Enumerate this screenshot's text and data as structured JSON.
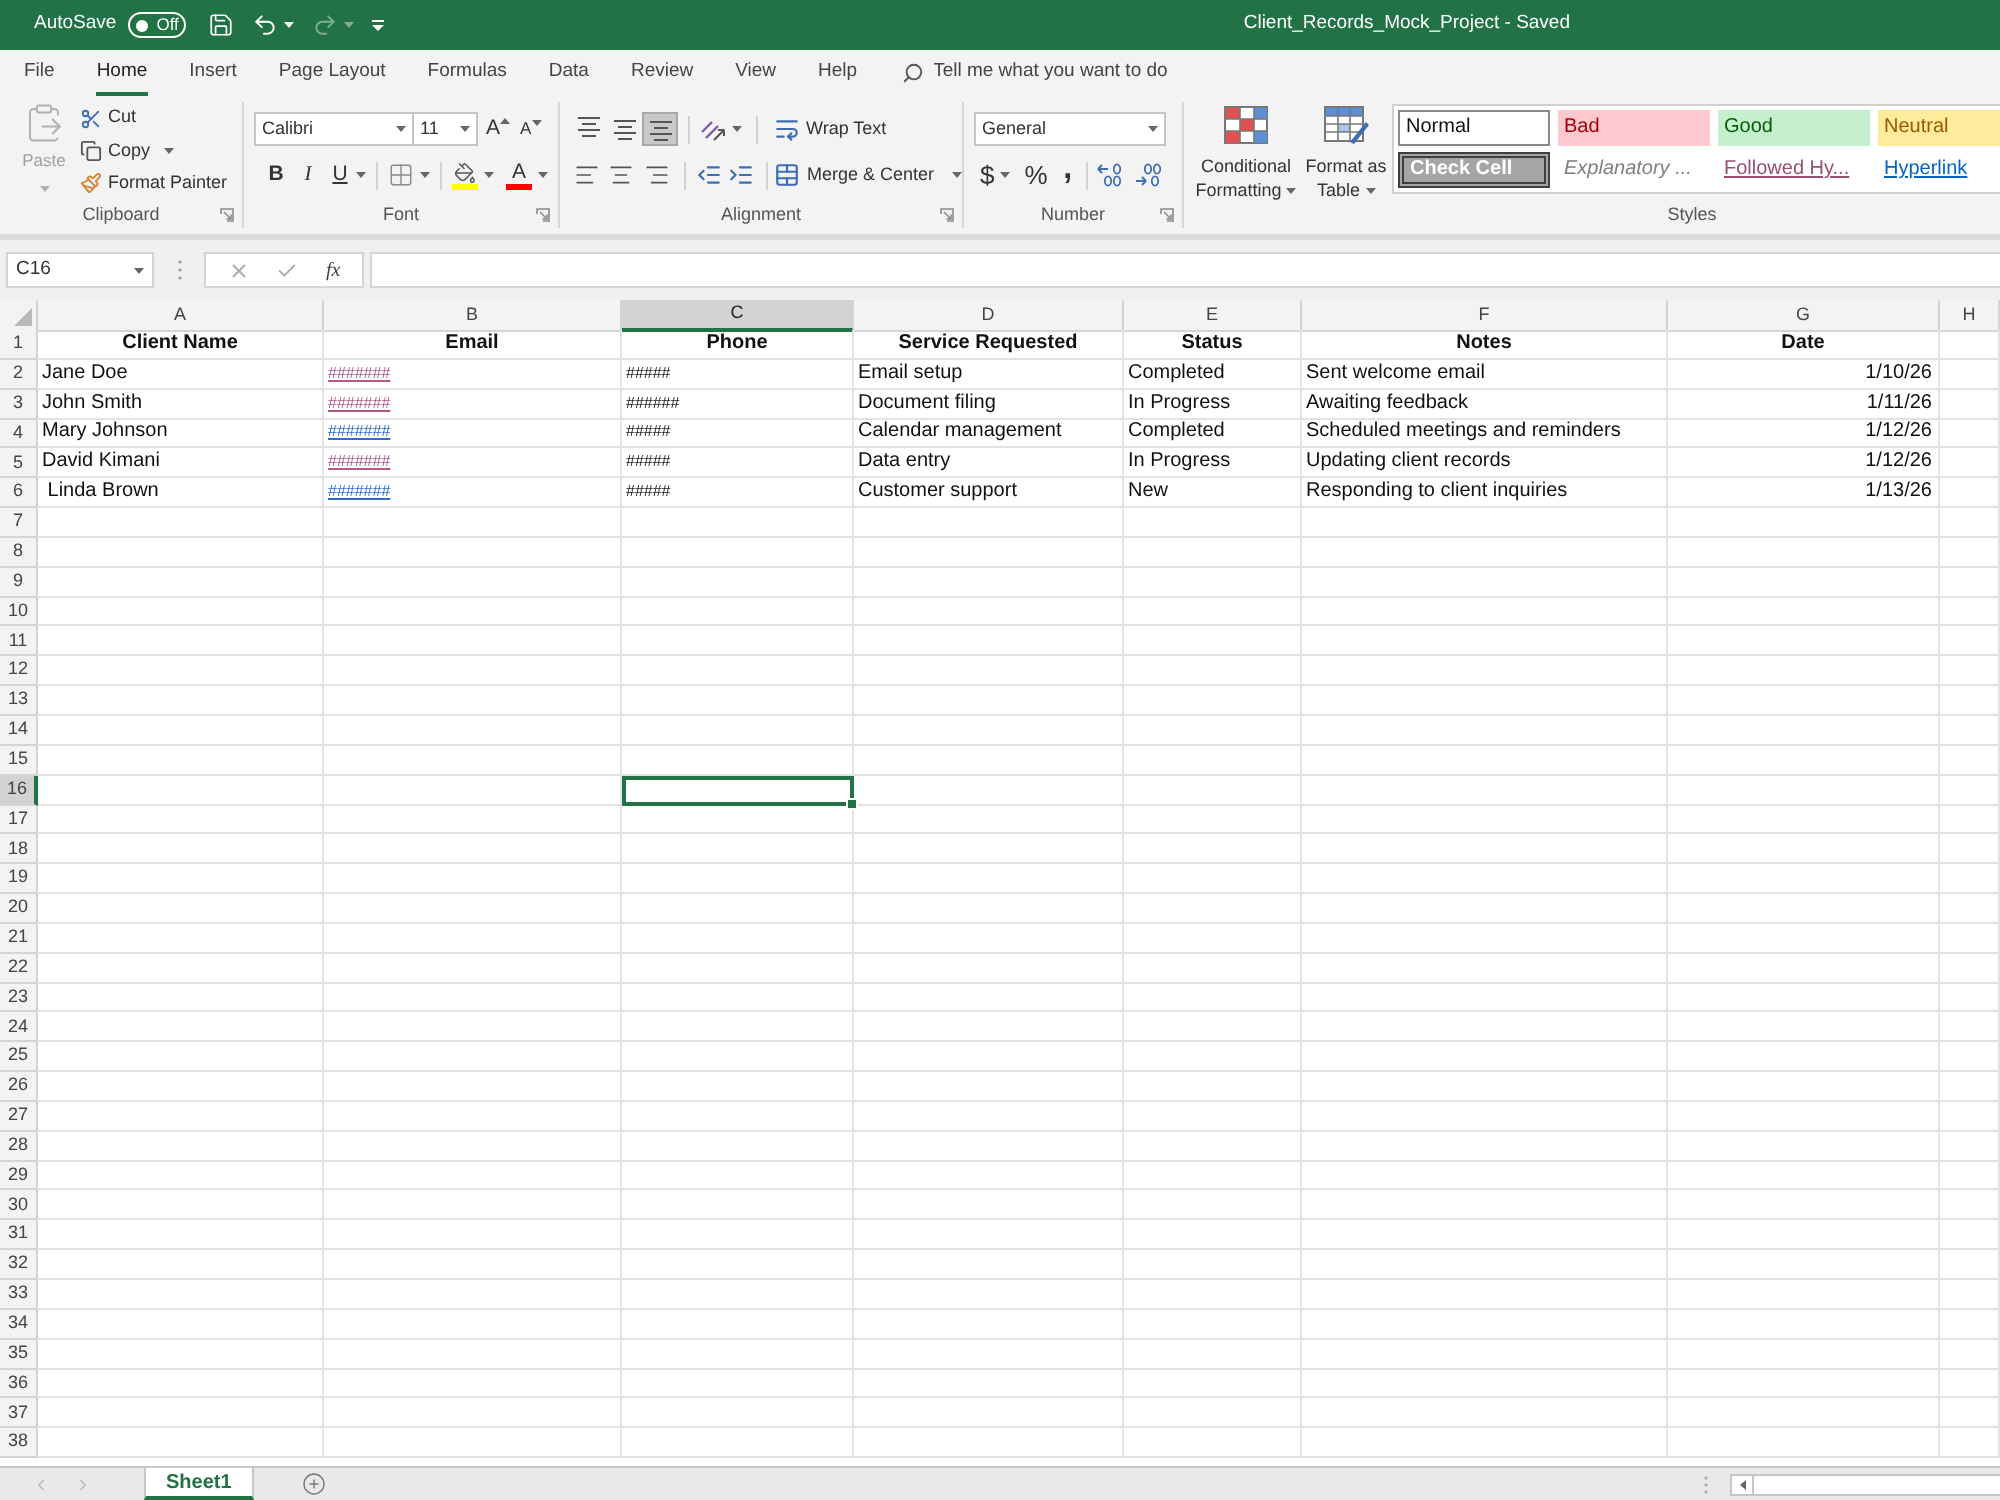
{
  "title_bar": {
    "autosave_label": "AutoSave",
    "autosave_toggle": {
      "label": "Off",
      "on": false
    },
    "quick_access": [
      {
        "kind": "save",
        "disabled": false
      },
      {
        "kind": "undo",
        "disabled": false
      },
      {
        "kind": "redo",
        "disabled": true
      },
      {
        "kind": "customize",
        "disabled": false
      }
    ],
    "title": "Client_Records_Mock_Project - Saved"
  },
  "menu_tabs": [
    {
      "label": "File",
      "selected": false
    },
    {
      "label": "Home",
      "selected": true
    },
    {
      "label": "Insert",
      "selected": false
    },
    {
      "label": "Page Layout",
      "selected": false
    },
    {
      "label": "Formulas",
      "selected": false
    },
    {
      "label": "Data",
      "selected": false
    },
    {
      "label": "Review",
      "selected": false
    },
    {
      "label": "View",
      "selected": false
    },
    {
      "label": "Help",
      "selected": false
    }
  ],
  "tell_me": {
    "placeholder": "Tell me what you want to do"
  },
  "ribbon": {
    "clipboard": {
      "label": "Clipboard",
      "paste": {
        "label": "Paste",
        "disabled": true
      },
      "cut": "Cut",
      "copy": "Copy",
      "format_painter": "Format Painter"
    },
    "font": {
      "label": "Font",
      "font_name": "Calibri",
      "font_size": "11",
      "grow_font": "A",
      "shrink_font": "A",
      "bold": "B",
      "italic": "I",
      "underline": "U",
      "font_color": "A"
    },
    "alignment": {
      "label": "Alignment",
      "vertical": [
        {
          "kind": "top",
          "selected": false
        },
        {
          "kind": "middle",
          "selected": false
        },
        {
          "kind": "bottom",
          "selected": true
        }
      ],
      "horizontal": [
        {
          "kind": "left",
          "selected": false
        },
        {
          "kind": "center",
          "selected": false
        },
        {
          "kind": "right",
          "selected": false
        }
      ],
      "wrap_text": "Wrap Text",
      "merge_center": "Merge & Center"
    },
    "number": {
      "label": "Number",
      "format": "General",
      "currency": "$",
      "percent": "%",
      "comma": ","
    },
    "styles": {
      "label": "Styles",
      "conditional_formatting": "Conditional Formatting",
      "format_as_table": "Format as Table",
      "gallery": [
        {
          "label": "Normal",
          "kind": "normal"
        },
        {
          "label": "Bad",
          "kind": "bad"
        },
        {
          "label": "Good",
          "kind": "good"
        },
        {
          "label": "Neutral",
          "kind": "neutral"
        },
        {
          "label": "Check Cell",
          "kind": "check"
        },
        {
          "label": "Explanatory ...",
          "kind": "explanatory"
        },
        {
          "label": "Followed Hy...",
          "kind": "followed"
        },
        {
          "label": "Hyperlink",
          "kind": "hyperlink"
        }
      ]
    }
  },
  "formula_bar": {
    "name_box": "C16",
    "function_label": "fx"
  },
  "sheet": {
    "columns": [
      {
        "label": "A",
        "selected": false
      },
      {
        "label": "B",
        "selected": false
      },
      {
        "label": "C",
        "selected": true
      },
      {
        "label": "D",
        "selected": false
      },
      {
        "label": "E",
        "selected": false
      },
      {
        "label": "F",
        "selected": false
      },
      {
        "label": "G",
        "selected": false
      },
      {
        "label": "H",
        "selected": false
      }
    ],
    "rows": [
      {
        "number": "1",
        "selected": false,
        "cells": [
          {
            "kind": "header",
            "text": "Client Name"
          },
          {
            "kind": "header",
            "text": "Email"
          },
          {
            "kind": "header",
            "text": "Phone"
          },
          {
            "kind": "header",
            "text": "Service Requested"
          },
          {
            "kind": "header",
            "text": "Status"
          },
          {
            "kind": "header",
            "text": "Notes"
          },
          {
            "kind": "header",
            "text": "Date"
          }
        ]
      },
      {
        "number": "2",
        "selected": false,
        "cells": [
          {
            "kind": "text",
            "text": "Jane Doe"
          },
          {
            "kind": "link",
            "text": "#######",
            "visited": true
          },
          {
            "kind": "number",
            "text": "#####"
          },
          {
            "kind": "text",
            "text": "Email setup"
          },
          {
            "kind": "text",
            "text": "Completed"
          },
          {
            "kind": "text",
            "text": "Sent welcome email"
          },
          {
            "kind": "date",
            "text": "1/10/26"
          }
        ]
      },
      {
        "number": "3",
        "selected": false,
        "cells": [
          {
            "kind": "text",
            "text": "John Smith"
          },
          {
            "kind": "link",
            "text": "#######",
            "visited": true
          },
          {
            "kind": "number",
            "text": "######"
          },
          {
            "kind": "text",
            "text": "Document filing"
          },
          {
            "kind": "text",
            "text": "In Progress"
          },
          {
            "kind": "text",
            "text": "Awaiting feedback"
          },
          {
            "kind": "date",
            "text": "1/11/26"
          }
        ]
      },
      {
        "number": "4",
        "selected": false,
        "cells": [
          {
            "kind": "text",
            "text": "Mary Johnson"
          },
          {
            "kind": "link",
            "text": "#######",
            "visited": false
          },
          {
            "kind": "number",
            "text": "#####"
          },
          {
            "kind": "text",
            "text": "Calendar management"
          },
          {
            "kind": "text",
            "text": "Completed"
          },
          {
            "kind": "text",
            "text": "Scheduled meetings and reminders"
          },
          {
            "kind": "date",
            "text": "1/12/26"
          }
        ]
      },
      {
        "number": "5",
        "selected": false,
        "cells": [
          {
            "kind": "text",
            "text": "David Kimani"
          },
          {
            "kind": "link",
            "text": "#######",
            "visited": true
          },
          {
            "kind": "number",
            "text": "#####"
          },
          {
            "kind": "text",
            "text": "Data entry"
          },
          {
            "kind": "text",
            "text": "In Progress"
          },
          {
            "kind": "text",
            "text": "Updating client records"
          },
          {
            "kind": "date",
            "text": "1/12/26"
          }
        ]
      },
      {
        "number": "6",
        "selected": false,
        "cells": [
          {
            "kind": "text",
            "text": " Linda Brown"
          },
          {
            "kind": "link",
            "text": "#######",
            "visited": false
          },
          {
            "kind": "number",
            "text": "#####"
          },
          {
            "kind": "text",
            "text": "Customer support"
          },
          {
            "kind": "text",
            "text": "New"
          },
          {
            "kind": "text",
            "text": "Responding to client inquiries"
          },
          {
            "kind": "date",
            "text": "1/13/26"
          }
        ]
      },
      {
        "number": "7",
        "selected": false
      },
      {
        "number": "8",
        "selected": false
      },
      {
        "number": "9",
        "selected": false
      },
      {
        "number": "10",
        "selected": false
      },
      {
        "number": "11",
        "selected": false
      },
      {
        "number": "12",
        "selected": false
      },
      {
        "number": "13",
        "selected": false
      },
      {
        "number": "14",
        "selected": false
      },
      {
        "number": "15",
        "selected": false
      },
      {
        "number": "16",
        "selected": true
      },
      {
        "number": "17",
        "selected": false
      },
      {
        "number": "18",
        "selected": false
      },
      {
        "number": "19",
        "selected": false
      },
      {
        "number": "20",
        "selected": false
      },
      {
        "number": "21",
        "selected": false
      },
      {
        "number": "22",
        "selected": false
      },
      {
        "number": "23",
        "selected": false
      },
      {
        "number": "24",
        "selected": false
      },
      {
        "number": "25",
        "selected": false
      },
      {
        "number": "26",
        "selected": false
      },
      {
        "number": "27",
        "selected": false
      },
      {
        "number": "28",
        "selected": false
      },
      {
        "number": "29",
        "selected": false
      },
      {
        "number": "30",
        "selected": false
      },
      {
        "number": "31",
        "selected": false
      },
      {
        "number": "32",
        "selected": false
      },
      {
        "number": "33",
        "selected": false
      },
      {
        "number": "34",
        "selected": false
      },
      {
        "number": "35",
        "selected": false
      },
      {
        "number": "36",
        "selected": false
      },
      {
        "number": "37",
        "selected": false
      },
      {
        "number": "38",
        "selected": false
      }
    ]
  },
  "sheet_tabs": [
    {
      "label": "Sheet1",
      "selected": true
    }
  ]
}
